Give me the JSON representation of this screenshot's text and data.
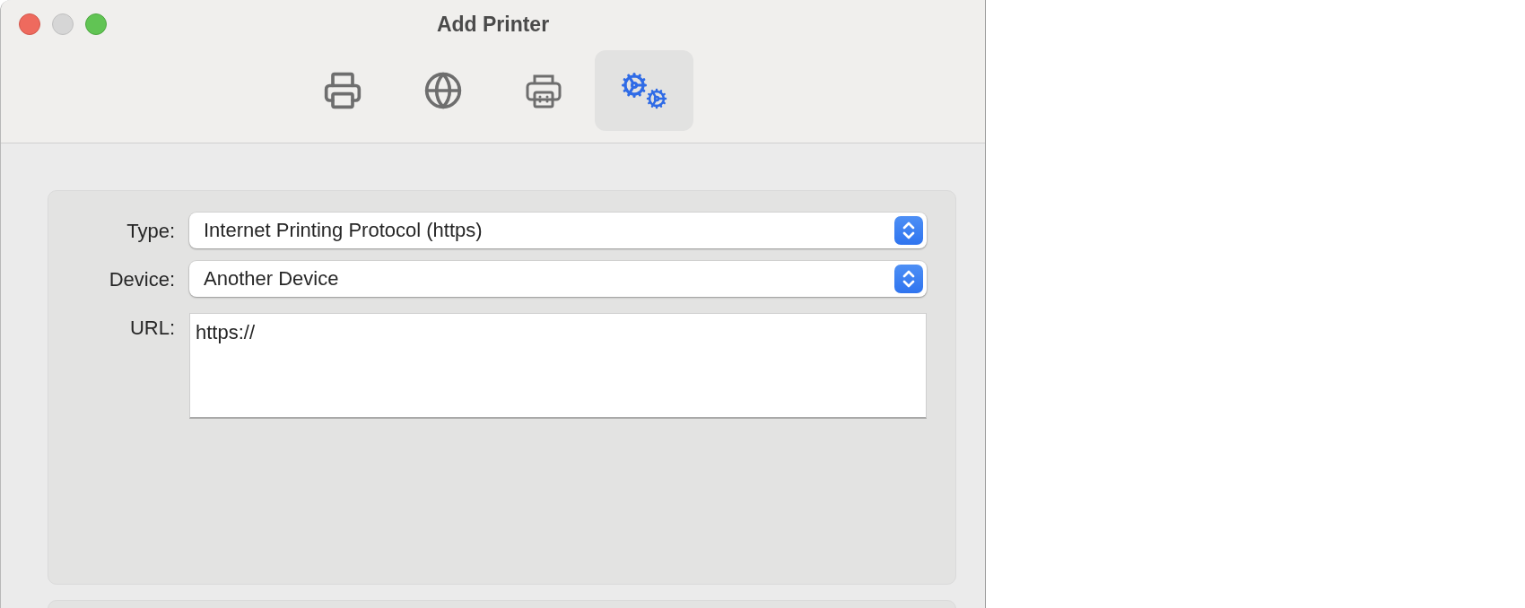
{
  "window": {
    "title": "Add Printer"
  },
  "toolbar": [
    {
      "selected": false
    },
    {
      "selected": false
    },
    {
      "selected": false
    },
    {
      "selected": true
    }
  ],
  "form": {
    "type": {
      "label": "Type:",
      "value": "Internet Printing Protocol (https)"
    },
    "device": {
      "label": "Device:",
      "value": "Another Device"
    },
    "url": {
      "label": "URL:",
      "value": "https://"
    }
  }
}
